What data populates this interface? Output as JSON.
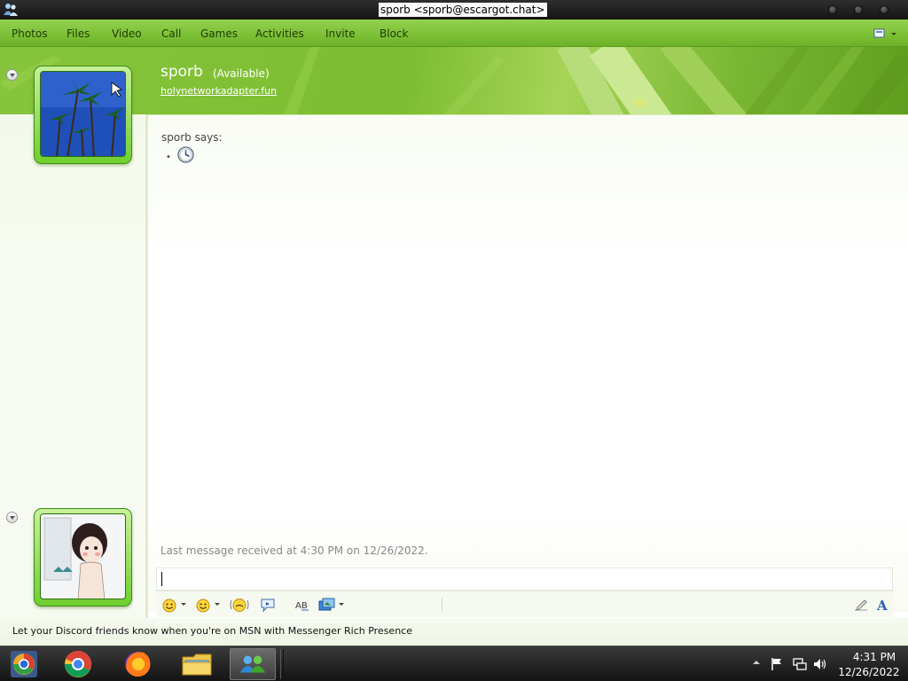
{
  "window": {
    "title": "sporb <sporb@escargot.chat>"
  },
  "menu": {
    "items": [
      "Photos",
      "Files",
      "Video",
      "Call",
      "Games",
      "Activities",
      "Invite",
      "Block"
    ]
  },
  "contact": {
    "name": "sporb",
    "status": "(Available)",
    "personal_message": "holynetworkadapter.fun"
  },
  "conversation": {
    "says": "sporb says:",
    "bullet": "•",
    "last_message": "Last message received at 4:30 PM on 12/26/2022."
  },
  "input": {
    "value": ""
  },
  "toolbar": {
    "icons": [
      "emoticon-icon",
      "wink-icon",
      "nudge-icon",
      "voice-clip-icon",
      "font-spell-icon",
      "background-icon",
      "handwriting-icon",
      "font-icon"
    ],
    "font_label": "A",
    "spell_label": "AB"
  },
  "ad": {
    "text": "Let your Discord friends know when you're on MSN with Messenger Rich Presence"
  },
  "taskbar": {
    "apps": [
      "chrome-canary-icon",
      "chrome-icon",
      "firefox-icon",
      "file-explorer-icon",
      "messenger-icon"
    ],
    "time": "4:31 PM",
    "date": "12/26/2022"
  },
  "colors": {
    "menu_green": "#7cc036",
    "banner_green": "#86c43c",
    "frame_green": "#6fcf2f"
  }
}
